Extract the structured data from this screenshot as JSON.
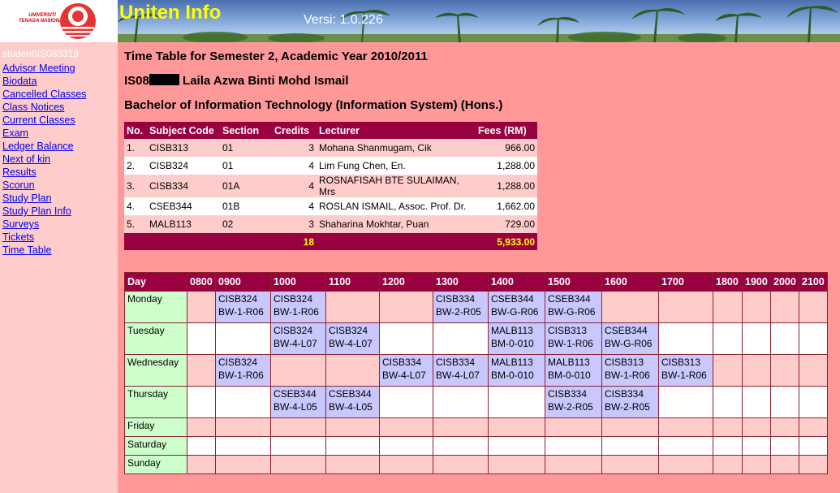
{
  "header": {
    "logo_text": "UNIVERSITI TENAGA NASIONAL",
    "title": "Uniten Info",
    "version": "Versi: 1.0.226"
  },
  "sidebar": {
    "student_id": "student\\IS083319",
    "items": [
      {
        "label": "Advisor Meeting"
      },
      {
        "label": "Biodata"
      },
      {
        "label": "Cancelled Classes"
      },
      {
        "label": "Class Notices"
      },
      {
        "label": "Current Classes"
      },
      {
        "label": "Exam"
      },
      {
        "label": "Ledger Balance"
      },
      {
        "label": "Next of kin"
      },
      {
        "label": "Results"
      },
      {
        "label": "Scorun"
      },
      {
        "label": "Study Plan"
      },
      {
        "label": "Study Plan Info"
      },
      {
        "label": "Surveys"
      },
      {
        "label": "Tickets"
      },
      {
        "label": "Time Table"
      }
    ]
  },
  "main": {
    "heading": "Time Table for Semester 2, Academic Year 2010/2011",
    "student_prefix": "IS08",
    "student_name": "Laila Azwa Binti Mohd Ismail",
    "programme": "Bachelor of Information Technology (Information System) (Hons.)"
  },
  "subjects": {
    "headers": {
      "no": "No.",
      "code": "Subject Code",
      "section": "Section",
      "credits": "Credits",
      "lecturer": "Lecturer",
      "fees": "Fees (RM)"
    },
    "rows": [
      {
        "no": "1.",
        "code": "CISB313",
        "section": "01",
        "credits": "3",
        "lecturer": "Mohana Shanmugam, Cik",
        "fees": "966.00"
      },
      {
        "no": "2.",
        "code": "CISB324",
        "section": "01",
        "credits": "4",
        "lecturer": "Lim Fung Chen, En.",
        "fees": "1,288.00"
      },
      {
        "no": "3.",
        "code": "CISB334",
        "section": "01A",
        "credits": "4",
        "lecturer": "ROSNAFISAH BTE SULAIMAN, Mrs",
        "fees": "1,288.00"
      },
      {
        "no": "4.",
        "code": "CSEB344",
        "section": "01B",
        "credits": "4",
        "lecturer": "ROSLAN ISMAIL, Assoc. Prof. Dr.",
        "fees": "1,662.00"
      },
      {
        "no": "5.",
        "code": "MALB113",
        "section": "02",
        "credits": "3",
        "lecturer": "Shaharina Mokhtar, Puan",
        "fees": "729.00"
      }
    ],
    "total_credits": "18",
    "total_fees": "5,933.00"
  },
  "timetable": {
    "day_header": "Day",
    "times": [
      "0800",
      "0900",
      "1000",
      "1100",
      "1200",
      "1300",
      "1400",
      "1500",
      "1600",
      "1700",
      "1800",
      "1900",
      "2000",
      "2100"
    ],
    "days": [
      {
        "name": "Monday",
        "cells": {
          "0900": [
            "CISB324",
            "BW-1-R06"
          ],
          "1000": [
            "CISB324",
            "BW-1-R06"
          ],
          "1300": [
            "CISB334",
            "BW-2-R05"
          ],
          "1400": [
            "CSEB344",
            "BW-G-R06"
          ],
          "1500": [
            "CSEB344",
            "BW-G-R06"
          ]
        }
      },
      {
        "name": "Tuesday",
        "cells": {
          "1000": [
            "CISB324",
            "BW-4-L07"
          ],
          "1100": [
            "CISB324",
            "BW-4-L07"
          ],
          "1400": [
            "MALB113",
            "BM-0-010"
          ],
          "1500": [
            "CISB313",
            "BW-1-R06"
          ],
          "1600": [
            "CSEB344",
            "BW-G-R06"
          ]
        }
      },
      {
        "name": "Wednesday",
        "cells": {
          "0900": [
            "CISB324",
            "BW-1-R06"
          ],
          "1200": [
            "CISB334",
            "BW-4-L07"
          ],
          "1300": [
            "CISB334",
            "BW-4-L07"
          ],
          "1400": [
            "MALB113",
            "BM-0-010"
          ],
          "1500": [
            "MALB113",
            "BM-0-010"
          ],
          "1600": [
            "CISB313",
            "BW-1-R06"
          ],
          "1700": [
            "CISB313",
            "BW-1-R06"
          ]
        }
      },
      {
        "name": "Thursday",
        "cells": {
          "1000": [
            "CSEB344",
            "BW-4-L05"
          ],
          "1100": [
            "CSEB344",
            "BW-4-L05"
          ],
          "1500": [
            "CISB334",
            "BW-2-R05"
          ],
          "1600": [
            "CISB334",
            "BW-2-R05"
          ]
        }
      },
      {
        "name": "Friday",
        "cells": {}
      },
      {
        "name": "Saturday",
        "cells": {}
      },
      {
        "name": "Sunday",
        "cells": {}
      }
    ]
  },
  "colors": {
    "page_bg": "#ff9999",
    "sidebar_bg": "#ffcccc",
    "table_header": "#99003f",
    "slot_bg": "#c8c8ff",
    "day_bg": "#ccffcc",
    "title_yellow": "#ffff00"
  }
}
